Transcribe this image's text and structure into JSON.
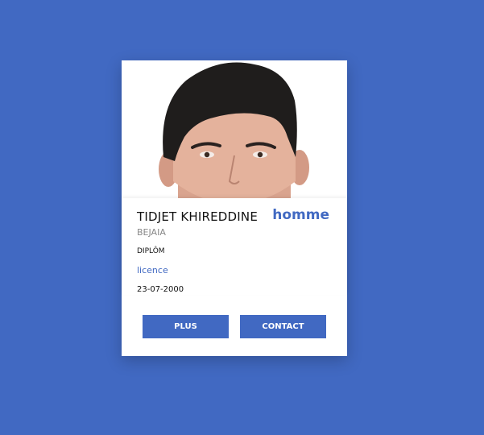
{
  "profile": {
    "name": "TIDJET KHIREDDINE",
    "gender": "homme",
    "city": "BEJAIA",
    "diploma_label": "DIPLÔM",
    "diploma_value": "licence",
    "birth_date": "23-07-2000"
  },
  "actions": {
    "plus_label": "PLUS",
    "contact_label": "CONTACT"
  },
  "colors": {
    "background": "#4169c2",
    "accent": "#4169c2",
    "card": "#ffffff"
  }
}
